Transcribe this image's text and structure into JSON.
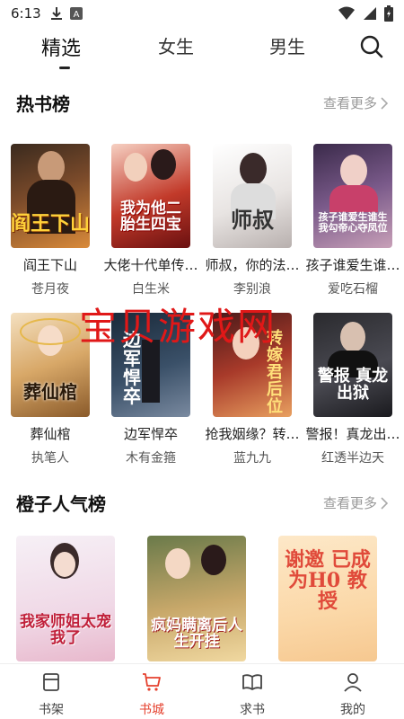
{
  "status": {
    "time": "6:13",
    "icons_left": [
      "download-icon",
      "font-icon"
    ],
    "icons_right": [
      "wifi-icon",
      "signal-icon",
      "battery-icon"
    ]
  },
  "top_tabs": [
    {
      "label": "精选",
      "active": true
    },
    {
      "label": "女生",
      "active": false
    },
    {
      "label": "男生",
      "active": false
    }
  ],
  "sections": {
    "hot": {
      "title": "热书榜",
      "more": "查看更多"
    },
    "orange": {
      "title": "橙子人气榜",
      "more": "查看更多"
    }
  },
  "hot_books": [
    {
      "title": "阎王下山",
      "author": "苍月夜",
      "cover_text": "阎王下山"
    },
    {
      "title": "大佬十代单传…",
      "author": "白生米",
      "cover_text": "我为他二胎生四宝"
    },
    {
      "title": "师叔，你的法…",
      "author": "李别浪",
      "cover_text": "师叔"
    },
    {
      "title": "孩子谁爱生谁…",
      "author": "爱吃石榴",
      "cover_text": "孩子谁爱生谁生 我勾帝心夺凤位"
    },
    {
      "title": "葬仙棺",
      "author": "执笔人",
      "cover_text": "葬仙棺"
    },
    {
      "title": "边军悍卒",
      "author": "木有金箍",
      "cover_text": "边军悍卒"
    },
    {
      "title": "抢我姻缘？转…",
      "author": "蓝九九",
      "cover_text": "转嫁君后位"
    },
    {
      "title": "警报！真龙出…",
      "author": "红透半边天",
      "cover_text": "警报 真龙出狱"
    }
  ],
  "orange_books": [
    {
      "cover_text": "我家师姐太宠我了"
    },
    {
      "cover_text": "疯妈瞒离后人生开挂"
    },
    {
      "cover_text": "谢邀 已成为H0 教授"
    }
  ],
  "watermark": "宝贝游戏网",
  "bottom_nav": [
    {
      "label": "书架",
      "icon": "bookshelf-icon",
      "active": false
    },
    {
      "label": "书城",
      "icon": "store-cart-icon",
      "active": true
    },
    {
      "label": "求书",
      "icon": "request-book-icon",
      "active": false
    },
    {
      "label": "我的",
      "icon": "profile-icon",
      "active": false
    }
  ],
  "colors": {
    "accent": "#e5412e",
    "watermark": "#e01818"
  }
}
